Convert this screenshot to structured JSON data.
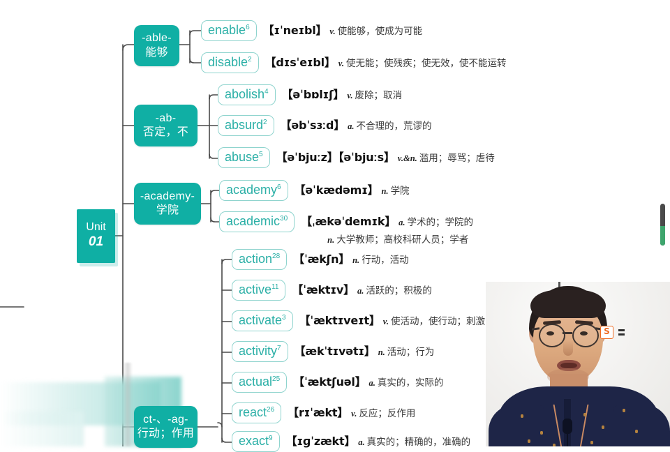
{
  "root": {
    "line1": "Unit",
    "line2": "01"
  },
  "branches": [
    {
      "id": "able",
      "affix": "-able-",
      "gloss": "能够"
    },
    {
      "id": "ab",
      "affix": "-ab-",
      "gloss": "否定，不"
    },
    {
      "id": "academy",
      "affix": "-academy-",
      "gloss": "学院"
    },
    {
      "id": "act",
      "affix": "ct-、-ag-",
      "gloss": "行动；作用"
    }
  ],
  "words": [
    {
      "word": "enable",
      "count": "6",
      "branch": "able",
      "ipa": "【ɪˈneɪbl】",
      "senses": [
        {
          "pos": "v.",
          "cn": "使能够，使成为可能"
        }
      ]
    },
    {
      "word": "disable",
      "count": "2",
      "branch": "able",
      "ipa": "【dɪsˈeɪbl】",
      "senses": [
        {
          "pos": "v.",
          "cn": "使无能；使残疾；使无效，使不能运转"
        }
      ]
    },
    {
      "word": "abolish",
      "count": "4",
      "branch": "ab",
      "ipa": "【əˈbɒlɪʃ】",
      "senses": [
        {
          "pos": "v.",
          "cn": "废除；取消"
        }
      ]
    },
    {
      "word": "absurd",
      "count": "2",
      "branch": "ab",
      "ipa": "【əbˈsɜːd】",
      "senses": [
        {
          "pos": "a.",
          "cn": "不合理的，荒谬的"
        }
      ]
    },
    {
      "word": "abuse",
      "count": "5",
      "branch": "ab",
      "ipa": "【əˈbjuːz】【əˈbjuːs】",
      "senses": [
        {
          "pos": "v.&n.",
          "cn": "滥用；辱骂；虐待"
        }
      ]
    },
    {
      "word": "academy",
      "count": "6",
      "branch": "academy",
      "ipa": "【əˈkædəmɪ】",
      "senses": [
        {
          "pos": "n.",
          "cn": "学院"
        }
      ]
    },
    {
      "word": "academic",
      "count": "30",
      "branch": "academy",
      "ipa": "【ˌækəˈdemɪk】",
      "senses": [
        {
          "pos": "a.",
          "cn": "学术的；学院的"
        },
        {
          "pos": "n.",
          "cn": "大学教师；高校科研人员；学者"
        }
      ]
    },
    {
      "word": "action",
      "count": "28",
      "branch": "act",
      "ipa": "【ˈækʃn】",
      "senses": [
        {
          "pos": "n.",
          "cn": "行动，活动"
        }
      ]
    },
    {
      "word": "active",
      "count": "11",
      "branch": "act",
      "ipa": "【ˈæktɪv】",
      "senses": [
        {
          "pos": "a.",
          "cn": "活跃的；积极的"
        }
      ]
    },
    {
      "word": "activate",
      "count": "3",
      "branch": "act",
      "ipa": "【ˈæktɪveɪt】",
      "senses": [
        {
          "pos": "v.",
          "cn": "使活动，使行动；刺激，激活"
        }
      ]
    },
    {
      "word": "activity",
      "count": "7",
      "branch": "act",
      "ipa": "【ækˈtɪvətɪ】",
      "senses": [
        {
          "pos": "n.",
          "cn": "活动；行为"
        }
      ]
    },
    {
      "word": "actual",
      "count": "25",
      "branch": "act",
      "ipa": "【ˈæktʃuəl】",
      "senses": [
        {
          "pos": "a.",
          "cn": "真实的，实际的"
        }
      ]
    },
    {
      "word": "react",
      "count": "26",
      "branch": "act",
      "ipa": "【rɪˈækt】",
      "senses": [
        {
          "pos": "v.",
          "cn": "反应；反作用"
        }
      ]
    },
    {
      "word": "exact",
      "count": "9",
      "branch": "act",
      "ipa": "【ɪɡˈzækt】",
      "senses": [
        {
          "pos": "a.",
          "cn": "真实的；精确的，准确的"
        }
      ]
    }
  ],
  "overlay": {
    "watermark_glyph": "S",
    "scrollbar_present": true
  },
  "colors": {
    "brand_teal": "#10AFA4",
    "chip_border": "#8FD4CE",
    "chip_text": "#2AAFA6",
    "connector": "#4a4a4a",
    "watermark_orange": "#EF6A21",
    "scroll_thumb_green": "#3EA56D"
  }
}
